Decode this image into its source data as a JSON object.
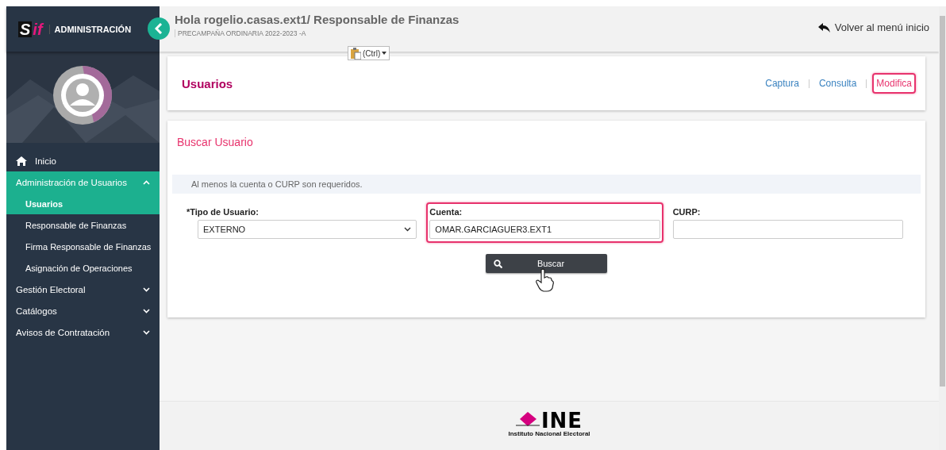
{
  "sidebar": {
    "logo": {
      "mark": "S",
      "accent": "if"
    },
    "title": "ADMINISTRACIÓN",
    "items": [
      {
        "kind": "link",
        "label": "Inicio",
        "selected": false
      },
      {
        "kind": "group",
        "label": "Administración de Usuarios",
        "expanded": true,
        "selected": true,
        "children": [
          {
            "label": "Usuarios",
            "selected": true
          },
          {
            "label": "Responsable de Finanzas",
            "selected": false
          },
          {
            "label": "Firma Responsable de Finanzas",
            "selected": false
          },
          {
            "label": "Asignación de Operaciones",
            "selected": false
          }
        ]
      },
      {
        "kind": "group",
        "label": "Gestión Electoral",
        "expanded": false,
        "selected": false
      },
      {
        "kind": "group",
        "label": "Catálogos",
        "expanded": false,
        "selected": false
      },
      {
        "kind": "group",
        "label": "Avisos de Contratación",
        "expanded": false,
        "selected": false
      }
    ]
  },
  "header": {
    "greeting": "Hola rogelio.casas.ext1/ Responsable de Finanzas",
    "subtitle": "PRECAMPAÑA ORDINARIA 2022-2023 -A",
    "back_link": "Volver al menú inicio",
    "paste_options": "(Ctrl)"
  },
  "page_card": {
    "title": "Usuarios",
    "links": [
      {
        "label": "Captura",
        "selected": false,
        "highlighted": false
      },
      {
        "label": "Consulta",
        "selected": false,
        "highlighted": false
      },
      {
        "label": "Modifica",
        "selected": true,
        "highlighted": true
      }
    ]
  },
  "search_card": {
    "title": "Buscar Usuario",
    "notice": "Al menos la cuenta o CURP son requeridos.",
    "fields": [
      {
        "kind": "select",
        "label": "*Tipo de Usuario:",
        "value": "EXTERNO",
        "highlighted": false
      },
      {
        "kind": "text",
        "label": "Cuenta:",
        "value": "OMAR.GARCIAGUER3.EXT1",
        "highlighted": true
      },
      {
        "kind": "text",
        "label": "CURP:",
        "highlighted": false
      }
    ],
    "button": "Buscar"
  },
  "footer": {
    "logo": {
      "name": "INE",
      "caption": "Instituto Nacional Electoral"
    }
  }
}
